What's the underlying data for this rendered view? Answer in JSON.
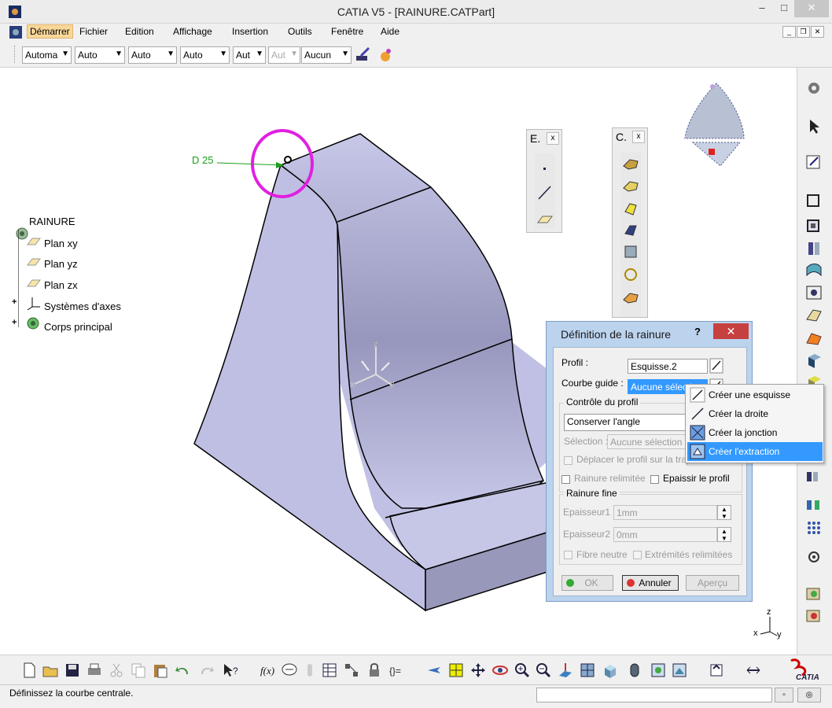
{
  "window": {
    "title": "CATIA V5 - [RAINURE.CATPart]",
    "minimize": "–",
    "maximize": "□",
    "close": "✕"
  },
  "menu": {
    "items": [
      "Démarrer",
      "Fichier",
      "Edition",
      "Affichage",
      "Insertion",
      "Outils",
      "Fenêtre",
      "Aide"
    ]
  },
  "toolbar": {
    "combos": [
      "Automa",
      "Auto",
      "Auto",
      "Auto",
      "Aut",
      "Aut",
      "Aucun"
    ]
  },
  "tree": {
    "root": "RAINURE",
    "items": [
      "Plan xy",
      "Plan yz",
      "Plan zx",
      "Systèmes d'axes",
      "Corps principal"
    ]
  },
  "viewport": {
    "dimension_label": "D 25",
    "axis_labels": {
      "z": "z",
      "x": "x",
      "y": "y"
    },
    "compass_labels": {
      "z": "z",
      "x": "x",
      "y": "y"
    },
    "highlight_color": "#e020e0",
    "part_color": "#c4c4e6"
  },
  "floating_toolbars": {
    "e_title": "E.",
    "c_title": "C.",
    "close": "x"
  },
  "dialog": {
    "title": "Définition de la rainure",
    "help": "?",
    "close": "✕",
    "profil_label": "Profil :",
    "profil_value": "Esquisse.2",
    "courbe_label": "Courbe guide :",
    "courbe_value": "Aucune sélection",
    "controle_group": "Contrôle du profil",
    "controle_value": "Conserver l'angle",
    "selection_label": "Sélection :",
    "selection_value": "Aucune sélection",
    "deplacer_label": "Déplacer le profil sur la trajectoire",
    "relimitee_label": "Rainure relimitée",
    "epaissir_label": "Epaissir le profil",
    "fine_group": "Rainure fine",
    "ep1_label": "Epaisseur1 :",
    "ep1_value": "1mm",
    "ep2_label": "Epaisseur2 :",
    "ep2_value": "0mm",
    "fibre_label": "Fibre neutre",
    "extremites_label": "Extrémités relimitées",
    "ok": "OK",
    "annuler": "Annuler",
    "apercu": "Aperçu"
  },
  "context_menu": {
    "items": [
      "Créer une esquisse",
      "Créer la droite",
      "Créer la jonction",
      "Créer l'extraction"
    ],
    "highlighted_index": 3
  },
  "status": {
    "message": "Définissez la courbe centrale."
  },
  "colors": {
    "accent_blue": "#3399ff",
    "close_red": "#c74040",
    "menu_active": "#f9d79a"
  }
}
